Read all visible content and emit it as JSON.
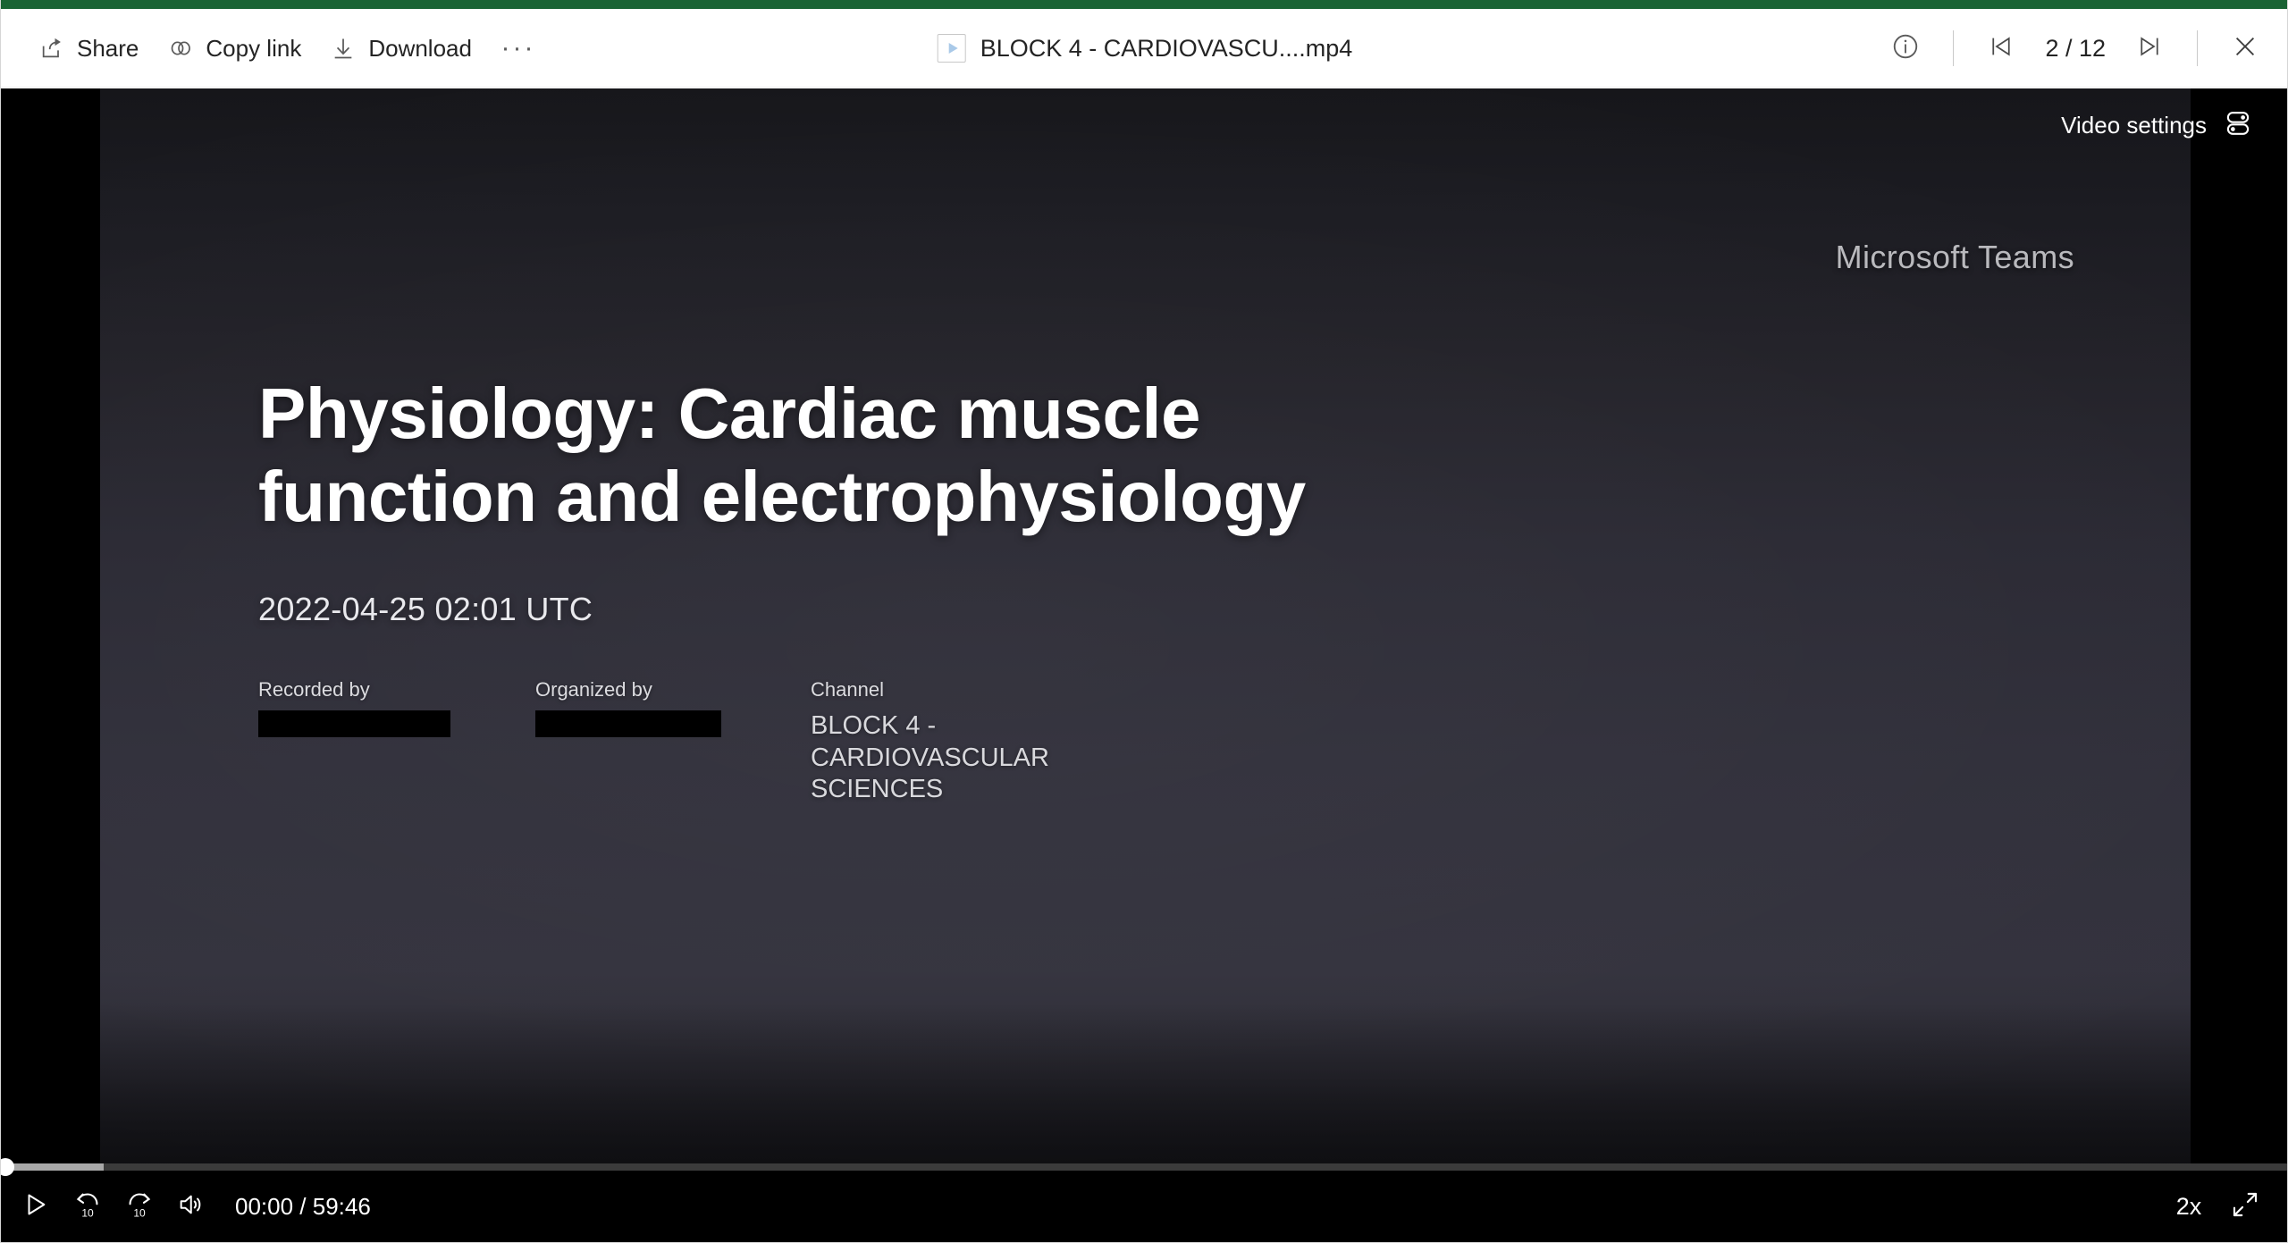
{
  "theme": {
    "accent_bar_color": "#1a6334",
    "command_bar_bg": "#ffffff",
    "stage_bg": "#000000",
    "text_primary": "#242424",
    "video_text": "#ffffff"
  },
  "command_bar": {
    "buttons": [
      {
        "label": "Share",
        "icon": "share-icon"
      },
      {
        "label": "Copy link",
        "icon": "copy-link-icon"
      },
      {
        "label": "Download",
        "icon": "download-icon"
      }
    ],
    "overflow_label": "···",
    "file_name": "BLOCK 4 - CARDIOVASCU....mp4",
    "file_icon": "video-file-icon",
    "info_icon": "info-icon",
    "previous_icon": "previous-item-icon",
    "next_icon": "next-item-icon",
    "page_counter": "2 / 12",
    "close_icon": "close-icon"
  },
  "video": {
    "settings_label": "Video settings",
    "settings_icon": "video-settings-toggles-icon",
    "watermark": "Microsoft Teams",
    "slide": {
      "title": "Physiology: Cardiac muscle function and electrophysiology",
      "date": "2022-04-25 02:01 UTC",
      "meta": [
        {
          "label": "Recorded by",
          "value": "",
          "redacted": true
        },
        {
          "label": "Organized by",
          "value": "",
          "redacted": true
        },
        {
          "label": "Channel",
          "value": "BLOCK 4 - CARDIOVASCULAR SCIENCES",
          "redacted": false
        }
      ]
    }
  },
  "player": {
    "play_icon": "play-icon",
    "rewind_label": "10",
    "rewind_icon": "rewind-10-icon",
    "forward_label": "10",
    "forward_icon": "forward-10-icon",
    "volume_icon": "volume-icon",
    "current_time": "00:00",
    "time_separator": "/",
    "duration": "59:46",
    "time_display": "00:00  /  59:46",
    "speed_label": "2x",
    "fullscreen_icon": "fullscreen-expand-icon",
    "progress_percent": 0,
    "buffered_percent": 4.5
  }
}
